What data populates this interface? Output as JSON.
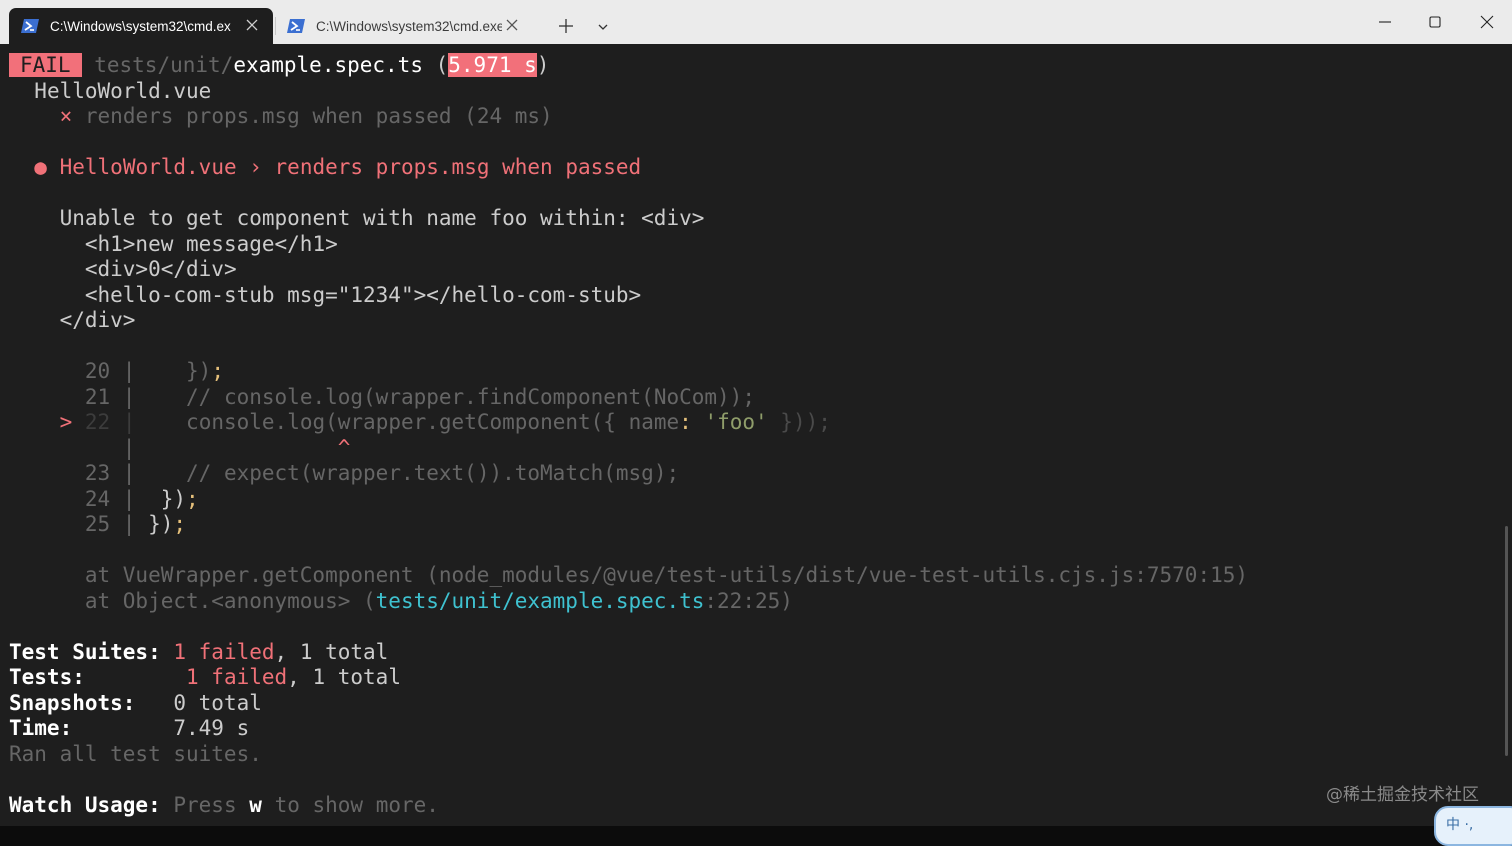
{
  "window": {
    "tabs": [
      {
        "label": "C:\\Windows\\system32\\cmd.ex",
        "icon": "powershell-icon",
        "active": true
      },
      {
        "label": "C:\\Windows\\system32\\cmd.exe",
        "icon": "powershell-icon",
        "active": false
      }
    ],
    "icons": {
      "new_tab": "plus-icon",
      "dropdown": "chevron-down-icon",
      "minimize": "minimize-icon",
      "maximize": "maximize-icon",
      "close": "close-icon"
    },
    "colors": {
      "titlebar": "#ebebeb",
      "terminal_bg": "#1e1e1e",
      "error": "#f2707a",
      "path_link": "#3fc2d0"
    }
  },
  "terminal": {
    "header": {
      "status": "FAIL",
      "path_prefix": "tests/unit/",
      "file": "example.spec.ts",
      "open_paren": " (",
      "duration": "5.971 s",
      "close_paren": ")"
    },
    "suite_name": "HelloWorld.vue",
    "test_result": {
      "mark": "×",
      "text": "renders props.msg when passed (24 ms)"
    },
    "error_title": {
      "bullet": "●",
      "text": "HelloWorld.vue › renders props.msg when passed"
    },
    "error_message": [
      "Unable to get component with name foo within: <div>",
      "  <h1>new message</h1>",
      "  <div>0</div>",
      "  <hello-com-stub msg=\"1234\"></hello-com-stub>",
      "</div>"
    ],
    "code_frame": {
      "l20_num": "20",
      "l20_code": "    })",
      "l20_semi": ";",
      "l21_num": "21",
      "l21_code": "    // console.log(wrapper.findComponent(NoCom));",
      "l22_marker": ">",
      "l22_num": "22",
      "l22_code_a": "    console.log(wrapper.getComponent({ name",
      "l22_colon": ":",
      "l22_string": " 'foo'",
      "l22_code_b": " }));",
      "caret": "^",
      "l23_num": "23",
      "l23_code": "    // expect(wrapper.text()).toMatch(msg);",
      "l24_num": "24",
      "l24_code": "  })",
      "l24_semi": ";",
      "l25_num": "25",
      "l25_code": "})",
      "l25_semi": ";",
      "separator": " |"
    },
    "stack": {
      "frame1": "at VueWrapper.getComponent (node_modules/@vue/test-utils/dist/vue-test-utils.cjs.js:7570:15)",
      "frame2_prefix": "at Object.<anonymous> (",
      "frame2_link": "tests/unit/example.spec.ts",
      "frame2_suffix": ":22:25)"
    },
    "summary": {
      "suites_label": "Test Suites:",
      "suites_failed": "1 failed",
      "suites_total": ", 1 total",
      "tests_label": "Tests:",
      "tests_failed": "1 failed",
      "tests_total": ", 1 total",
      "snapshots_label": "Snapshots:",
      "snapshots_value": "0 total",
      "time_label": "Time:",
      "time_value": "7.49 s",
      "ran_all": "Ran all test suites."
    },
    "watch": {
      "label": "Watch Usage:",
      "press": "Press",
      "key": "w",
      "rest": "to show more."
    }
  },
  "watermark": "@稀土掘金技术社区",
  "ime": "中 ·,"
}
